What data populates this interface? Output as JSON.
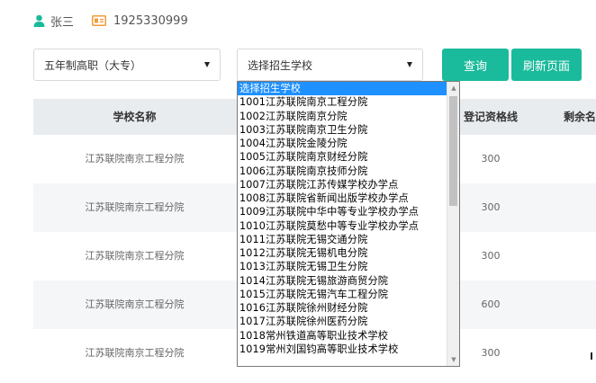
{
  "user": {
    "name": "张三",
    "id_number": "1925330999"
  },
  "controls": {
    "grade_select_value": "五年制高职（大专）",
    "school_select_value": "选择招生学校",
    "query_label": "查询",
    "refresh_label": "刷新页面"
  },
  "table": {
    "headers": {
      "school": "学校名称",
      "line": "登记资格线",
      "remain": "剩余名"
    },
    "rows": [
      {
        "school": "江苏联院南京工程分院",
        "line": "300"
      },
      {
        "school": "江苏联院南京工程分院",
        "line": "300"
      },
      {
        "school": "江苏联院南京工程分院",
        "line": "300"
      },
      {
        "school": "江苏联院南京工程分院",
        "line": "600"
      },
      {
        "school": "江苏联院南京工程分院",
        "line": "300"
      }
    ]
  },
  "dropdown": {
    "options": [
      "选择招生学校",
      "1001江苏联院南京工程分院",
      "1002江苏联院南京分院",
      "1003江苏联院南京卫生分院",
      "1004江苏联院金陵分院",
      "1005江苏联院南京财经分院",
      "1006江苏联院南京技师分院",
      "1007江苏联院江苏传媒学校办学点",
      "1008江苏联院省新闻出版学校办学点",
      "1009江苏联院中华中等专业学校办学点",
      "1010江苏联院莫愁中等专业学校办学点",
      "1011江苏联院无锡交通分院",
      "1012江苏联院无锡机电分院",
      "1013江苏联院无锡卫生分院",
      "1014江苏联院无锡旅游商贸分院",
      "1015江苏联院无锡汽车工程分院",
      "1016江苏联院徐州财经分院",
      "1017江苏联院徐州医药分院",
      "1018常州铁道高等职业技术学校",
      "1019常州刘国钧高等职业技术学校"
    ],
    "selected_index": 0
  },
  "colors": {
    "accent": "#1aba9c",
    "selected_option": "#1e90ff",
    "table_header": "#e9ecef"
  }
}
